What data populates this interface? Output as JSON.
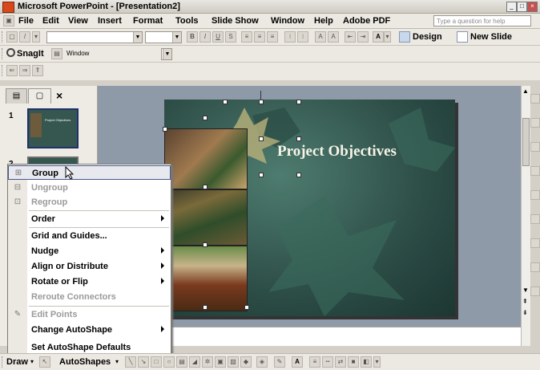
{
  "window": {
    "title": "Microsoft PowerPoint - [Presentation2]",
    "buttons": [
      "_",
      "□",
      "×"
    ]
  },
  "menubar": {
    "items": [
      "File",
      "Edit",
      "View",
      "Insert",
      "Format",
      "Tools",
      "Slide Show",
      "Window",
      "Help",
      "Adobe PDF"
    ],
    "help_placeholder": "Type a question for help"
  },
  "formatting_toolbar": {
    "bold": "B",
    "italic": "I",
    "underline": "U",
    "shadow": "S",
    "font_color": "A",
    "design_label": "Design",
    "new_slide_label": "New Slide"
  },
  "snagit_toolbar": {
    "label": "SnagIt",
    "mode_value": "Window"
  },
  "slides_pane": {
    "close_glyph": "×",
    "slides": [
      {
        "number": "1",
        "caption": "Project Objectives"
      },
      {
        "number": "2"
      }
    ]
  },
  "slide": {
    "title": "Project Objectives"
  },
  "context_menu": {
    "items": [
      {
        "label": "Group",
        "enabled": true,
        "submenu": false,
        "hover": true
      },
      {
        "label": "Ungroup",
        "enabled": false,
        "submenu": false
      },
      {
        "label": "Regroup",
        "enabled": false,
        "submenu": false
      },
      {
        "label": "Order",
        "enabled": true,
        "submenu": true
      },
      {
        "label": "Grid and Guides...",
        "enabled": true,
        "submenu": false
      },
      {
        "label": "Nudge",
        "enabled": true,
        "submenu": true
      },
      {
        "label": "Align or Distribute",
        "enabled": true,
        "submenu": true
      },
      {
        "label": "Rotate or Flip",
        "enabled": true,
        "submenu": true
      },
      {
        "label": "Reroute Connectors",
        "enabled": false,
        "submenu": false
      },
      {
        "label": "Edit Points",
        "enabled": false,
        "submenu": false
      },
      {
        "label": "Change AutoShape",
        "enabled": true,
        "submenu": true
      },
      {
        "label": "Set AutoShape Defaults",
        "enabled": true,
        "submenu": false
      }
    ]
  },
  "draw_toolbar": {
    "draw_label": "Draw",
    "autoshapes_label": "AutoShapes",
    "font_color": "A"
  },
  "colors": {
    "slide_bg": "#2c4c46",
    "title_text": "#f6f4e8",
    "menu_highlight_border": "#47578a",
    "workspace": "#8f9aa9"
  }
}
